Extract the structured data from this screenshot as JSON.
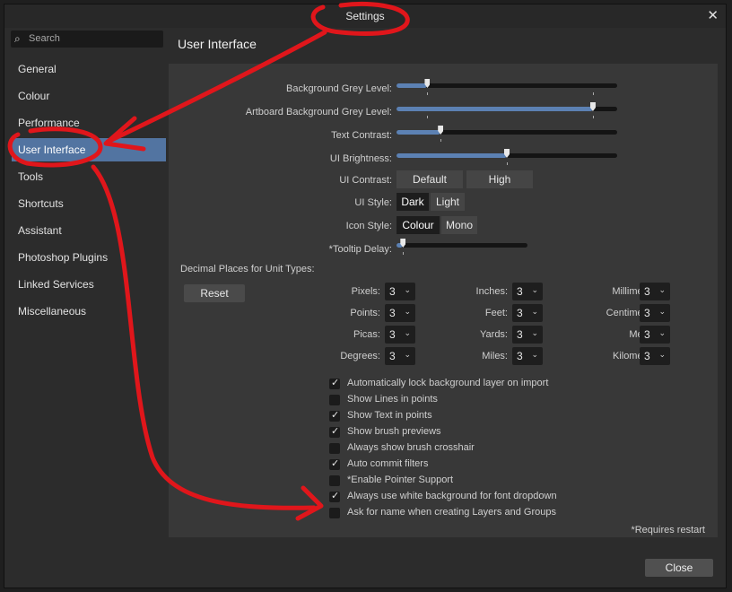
{
  "window": {
    "title": "Settings",
    "close_glyph": "✕"
  },
  "search": {
    "placeholder": "Search",
    "icon": "search-icon"
  },
  "sidebar": {
    "items": [
      {
        "label": "General",
        "active": false
      },
      {
        "label": "Colour",
        "active": false
      },
      {
        "label": "Performance",
        "active": false
      },
      {
        "label": "User Interface",
        "active": true
      },
      {
        "label": "Tools",
        "active": false
      },
      {
        "label": "Shortcuts",
        "active": false
      },
      {
        "label": "Assistant",
        "active": false
      },
      {
        "label": "Photoshop Plugins",
        "active": false
      },
      {
        "label": "Linked Services",
        "active": false
      },
      {
        "label": "Miscellaneous",
        "active": false
      }
    ]
  },
  "section": {
    "title": "User Interface"
  },
  "sliders": [
    {
      "label": "Background Grey Level:",
      "value": 0.14
    },
    {
      "label": "Artboard Background Grey Level:",
      "value": 0.89
    },
    {
      "label": "Text Contrast:",
      "value": 0.2
    },
    {
      "label": "UI Brightness:",
      "value": 0.5
    }
  ],
  "ui_contrast": {
    "label": "UI Contrast:",
    "options": [
      "Default",
      "High"
    ]
  },
  "ui_style": {
    "label": "UI Style:",
    "options": [
      "Dark",
      "Light"
    ],
    "selected": "Dark"
  },
  "icon_style": {
    "label": "Icon Style:",
    "options": [
      "Colour",
      "Mono"
    ],
    "selected": "Colour"
  },
  "tooltip_delay": {
    "label": "*Tooltip Delay:",
    "value": 0.05
  },
  "decimal": {
    "heading": "Decimal Places for Unit Types:",
    "reset_label": "Reset",
    "units": [
      [
        {
          "label": "Pixels:",
          "value": "3"
        },
        {
          "label": "Inches:",
          "value": "3"
        },
        {
          "label": "Millimetres:",
          "value": "3"
        }
      ],
      [
        {
          "label": "Points:",
          "value": "3"
        },
        {
          "label": "Feet:",
          "value": "3"
        },
        {
          "label": "Centimetres:",
          "value": "3"
        }
      ],
      [
        {
          "label": "Picas:",
          "value": "3"
        },
        {
          "label": "Yards:",
          "value": "3"
        },
        {
          "label": "Metres:",
          "value": "3"
        }
      ],
      [
        {
          "label": "Degrees:",
          "value": "3"
        },
        {
          "label": "Miles:",
          "value": "3"
        },
        {
          "label": "Kilometres:",
          "value": "3"
        }
      ]
    ]
  },
  "checkboxes": [
    {
      "label": "Automatically lock background layer on import",
      "checked": true
    },
    {
      "label": "Show Lines in points",
      "checked": false
    },
    {
      "label": "Show Text in points",
      "checked": true
    },
    {
      "label": "Show brush previews",
      "checked": true
    },
    {
      "label": "Always show brush crosshair",
      "checked": false
    },
    {
      "label": "Auto commit filters",
      "checked": true
    },
    {
      "label": "*Enable Pointer Support",
      "checked": false
    },
    {
      "label": "Always use white background for font dropdown",
      "checked": true
    },
    {
      "label": "Ask for name when creating Layers and Groups",
      "checked": false
    }
  ],
  "restart_note": "*Requires restart",
  "footer": {
    "close_label": "Close"
  },
  "colors": {
    "accent": "#5274a1",
    "annotation": "#e0161b"
  }
}
